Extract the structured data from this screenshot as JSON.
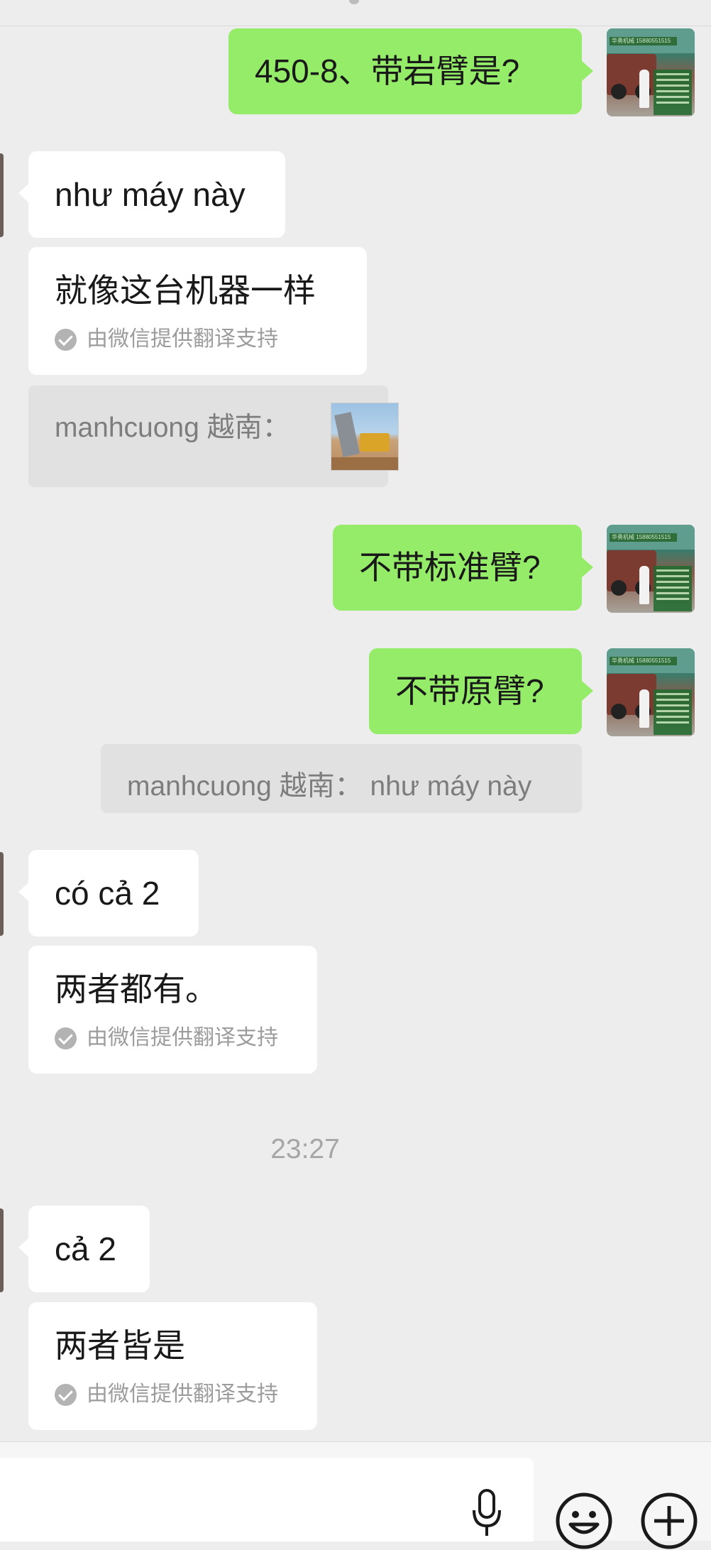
{
  "messages": [
    {
      "text": "450-8、带岩臂是?"
    },
    {
      "text": "như máy này"
    },
    {
      "text": "就像这台机器一样",
      "translation_note": "由微信提供翻译支持"
    },
    {
      "quote": "manhcuong 越南："
    },
    {
      "text": "不带标准臂?"
    },
    {
      "text": "不带原臂?"
    },
    {
      "quote": "manhcuong 越南： như máy này"
    },
    {
      "text": "có cả 2"
    },
    {
      "text": "两者都有。",
      "translation_note": "由微信提供翻译支持"
    },
    {
      "text": "cả 2"
    },
    {
      "text": "两者皆是",
      "translation_note": "由微信提供翻译支持"
    }
  ],
  "timestamp": "23:27",
  "avatar_banner": "华勇机械 15880551515",
  "colors": {
    "background": "#ededed",
    "incoming_bubble": "#ffffff",
    "outgoing_bubble": "#95ec69",
    "quote_block": "#e1e1e1",
    "muted_text": "#9c9c9c"
  },
  "icons": {
    "mic": "microphone-icon",
    "emoji": "smiley-face-icon",
    "more": "plus-circle-icon",
    "translation": "check-circle-icon"
  }
}
